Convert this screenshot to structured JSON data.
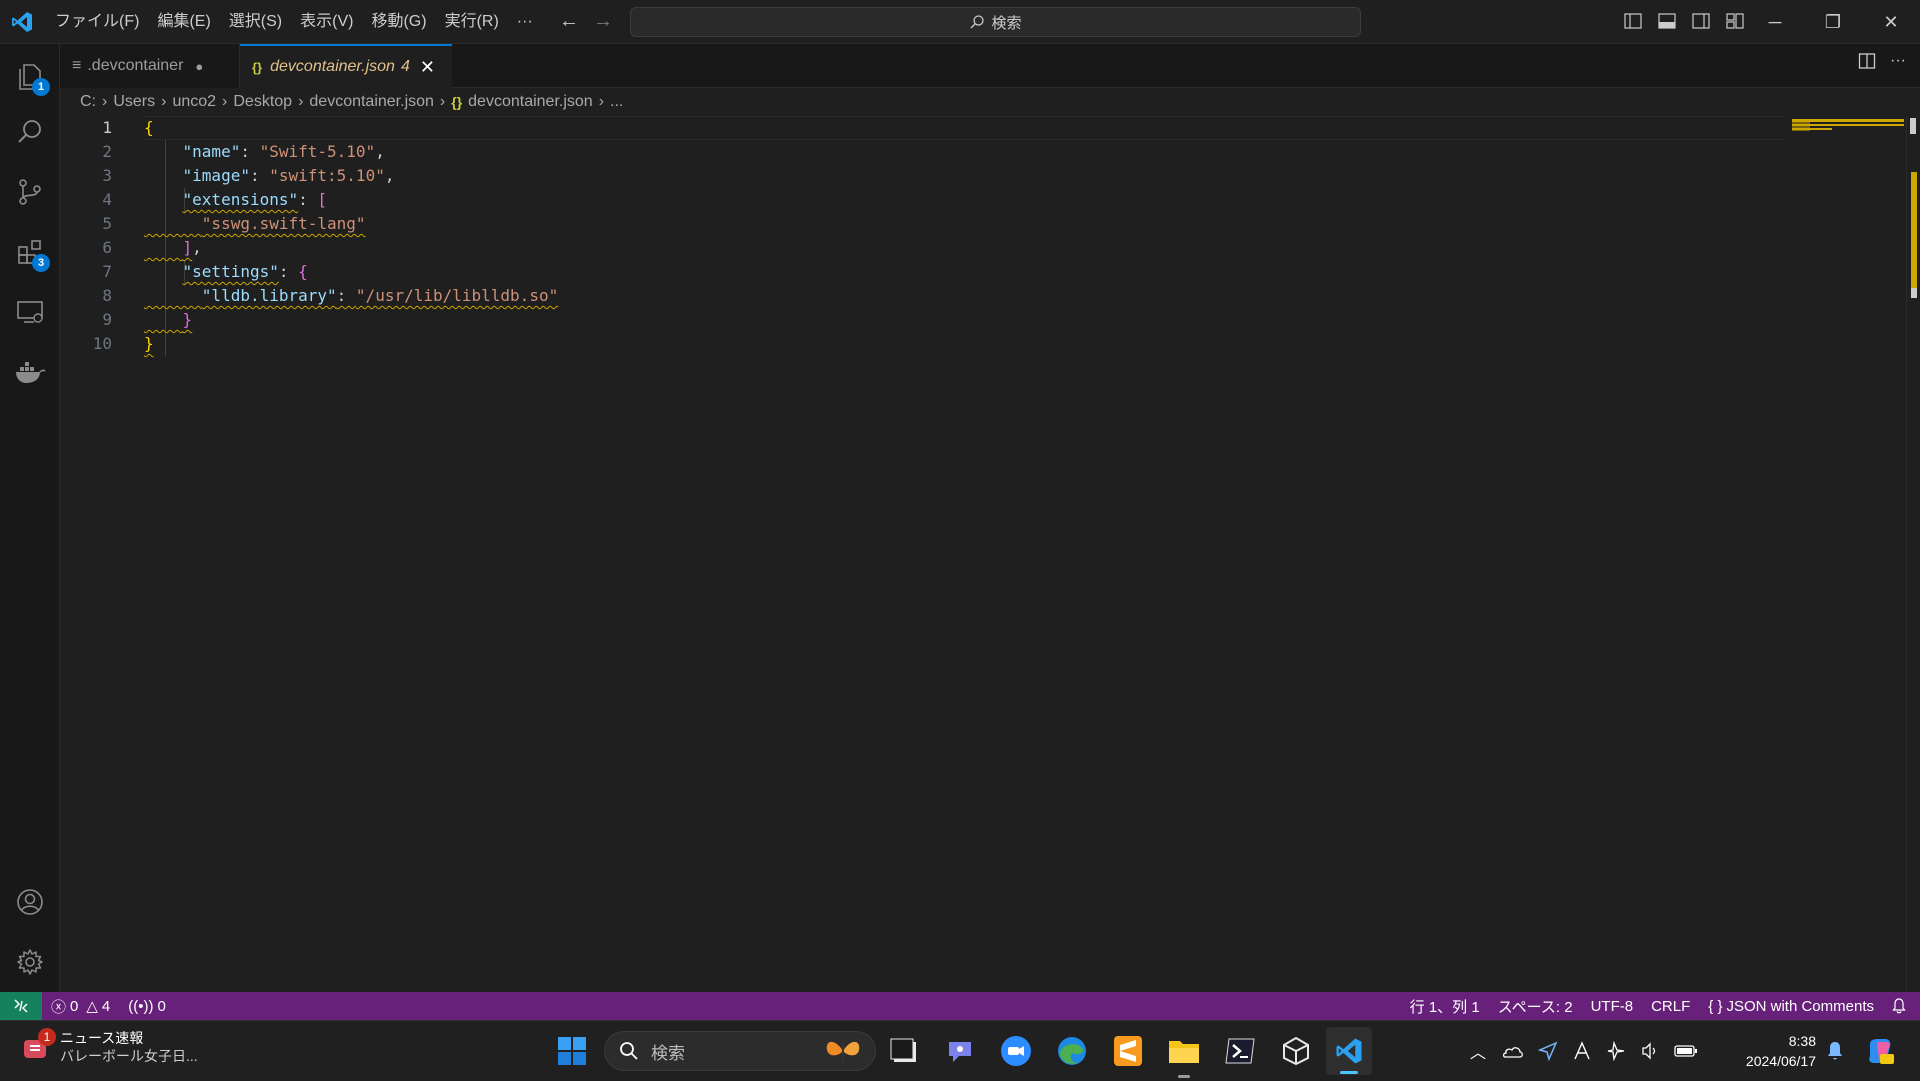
{
  "titlebar": {
    "menu": [
      "ファイル(F)",
      "編集(E)",
      "選択(S)",
      "表示(V)",
      "移動(G)",
      "実行(R)",
      "···"
    ],
    "search_placeholder": "検索"
  },
  "activitybar": {
    "explorer_badge": "1",
    "extensions_badge": "3"
  },
  "tabs": [
    {
      "label": ".devcontainer",
      "modified_dot": "●",
      "icon": "≡"
    },
    {
      "label": "devcontainer.json",
      "problems": "4",
      "icon": "{}",
      "close": "✕"
    }
  ],
  "breadcrumb": [
    "C:",
    "Users",
    "unco2",
    "Desktop",
    "devcontainer.json",
    "devcontainer.json",
    "..."
  ],
  "editor": {
    "line_numbers": [
      "1",
      "2",
      "3",
      "4",
      "5",
      "6",
      "7",
      "8",
      "9",
      "10"
    ],
    "lines": {
      "name_key": "\"name\"",
      "name_val": "\"Swift-5.10\"",
      "image_key": "\"image\"",
      "image_val": "\"swift:5.10\"",
      "ext_key": "\"extensions\"",
      "ext_item": "\"sswg.swift-lang\"",
      "settings_key": "\"settings\"",
      "lldb_key": "\"lldb.library\"",
      "lldb_val": "\"/usr/lib/liblldb.so\""
    }
  },
  "statusbar": {
    "errors": "0",
    "warnings": "4",
    "ports": "0",
    "position": "行 1、列 1",
    "spaces": "スペース: 2",
    "encoding": "UTF-8",
    "eol": "CRLF",
    "language": "JSON with Comments"
  },
  "taskbar": {
    "news_badge": "1",
    "news_title": "ニュース速報",
    "news_sub": "バレーボール女子日...",
    "search_placeholder": "検索",
    "time": "8:38",
    "date": "2024/06/17"
  },
  "colors": {
    "statusbar": "#68217a",
    "remote": "#16825d",
    "accent": "#0078d4"
  }
}
